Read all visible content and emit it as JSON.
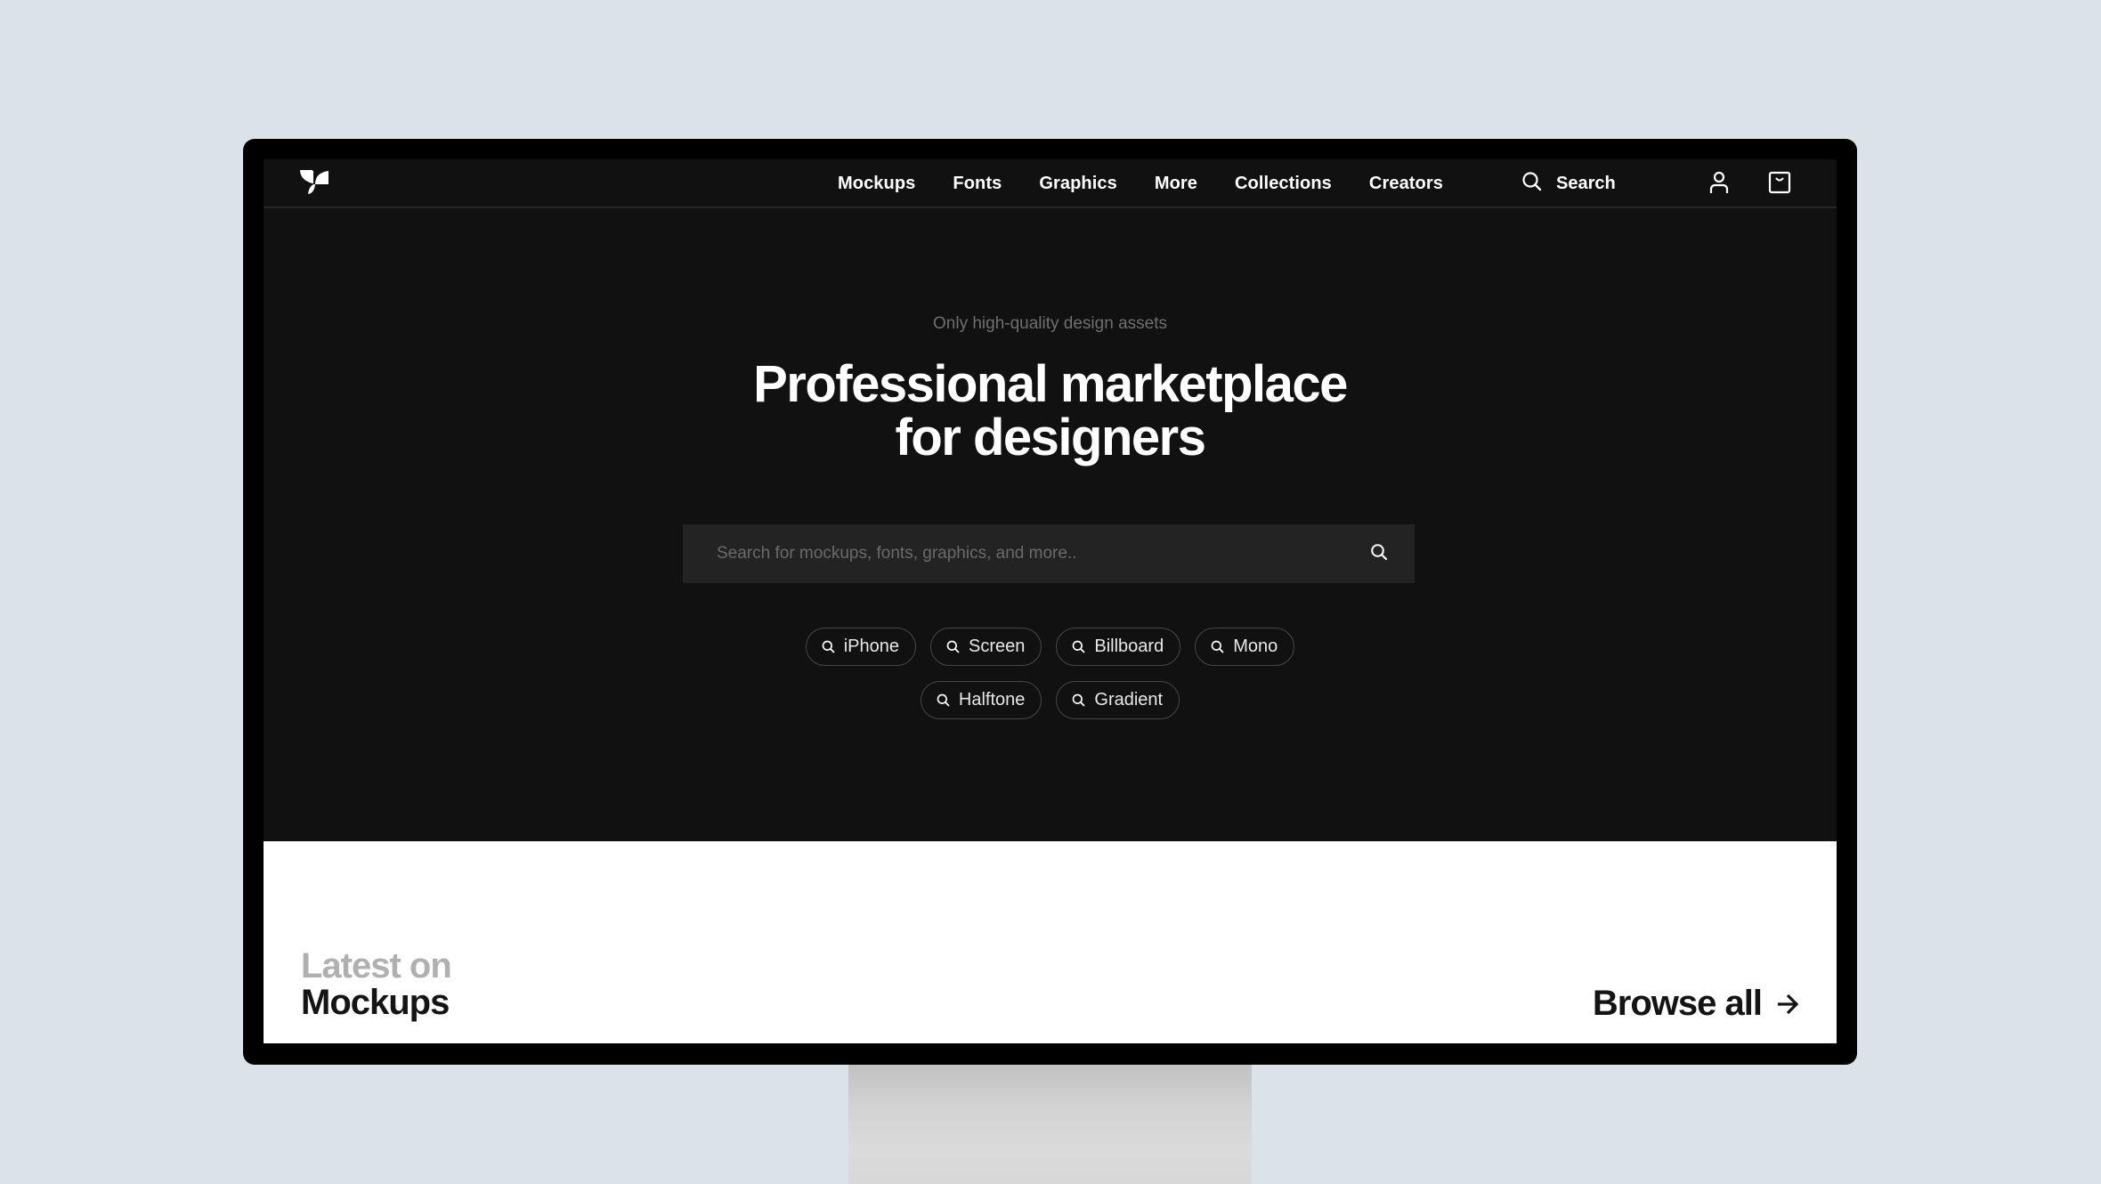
{
  "nav": {
    "logo": "brand-leaf-logo",
    "links": [
      "Mockups",
      "Fonts",
      "Graphics",
      "More",
      "Collections",
      "Creators"
    ],
    "search_label": "Search",
    "icons": {
      "search": "search-icon",
      "account": "user-icon",
      "cart": "bag-icon"
    }
  },
  "hero": {
    "tagline": "Only high-quality design assets",
    "title_line1": "Professional marketplace",
    "title_line2": "for designers",
    "search": {
      "placeholder": "Search for mockups, fonts, graphics, and more..",
      "value": ""
    },
    "chips_row1": [
      "iPhone",
      "Screen",
      "Billboard",
      "Mono"
    ],
    "chips_row2": [
      "Halftone",
      "Gradient"
    ]
  },
  "latest": {
    "line1": "Latest on",
    "line2": "Mockups",
    "browse_label": "Browse all"
  },
  "colors": {
    "page_bg": "#dbe3e9",
    "hero_bg": "#111111",
    "search_bg": "#232323",
    "text_light": "#ffffff",
    "muted": "#6f6f6f"
  }
}
